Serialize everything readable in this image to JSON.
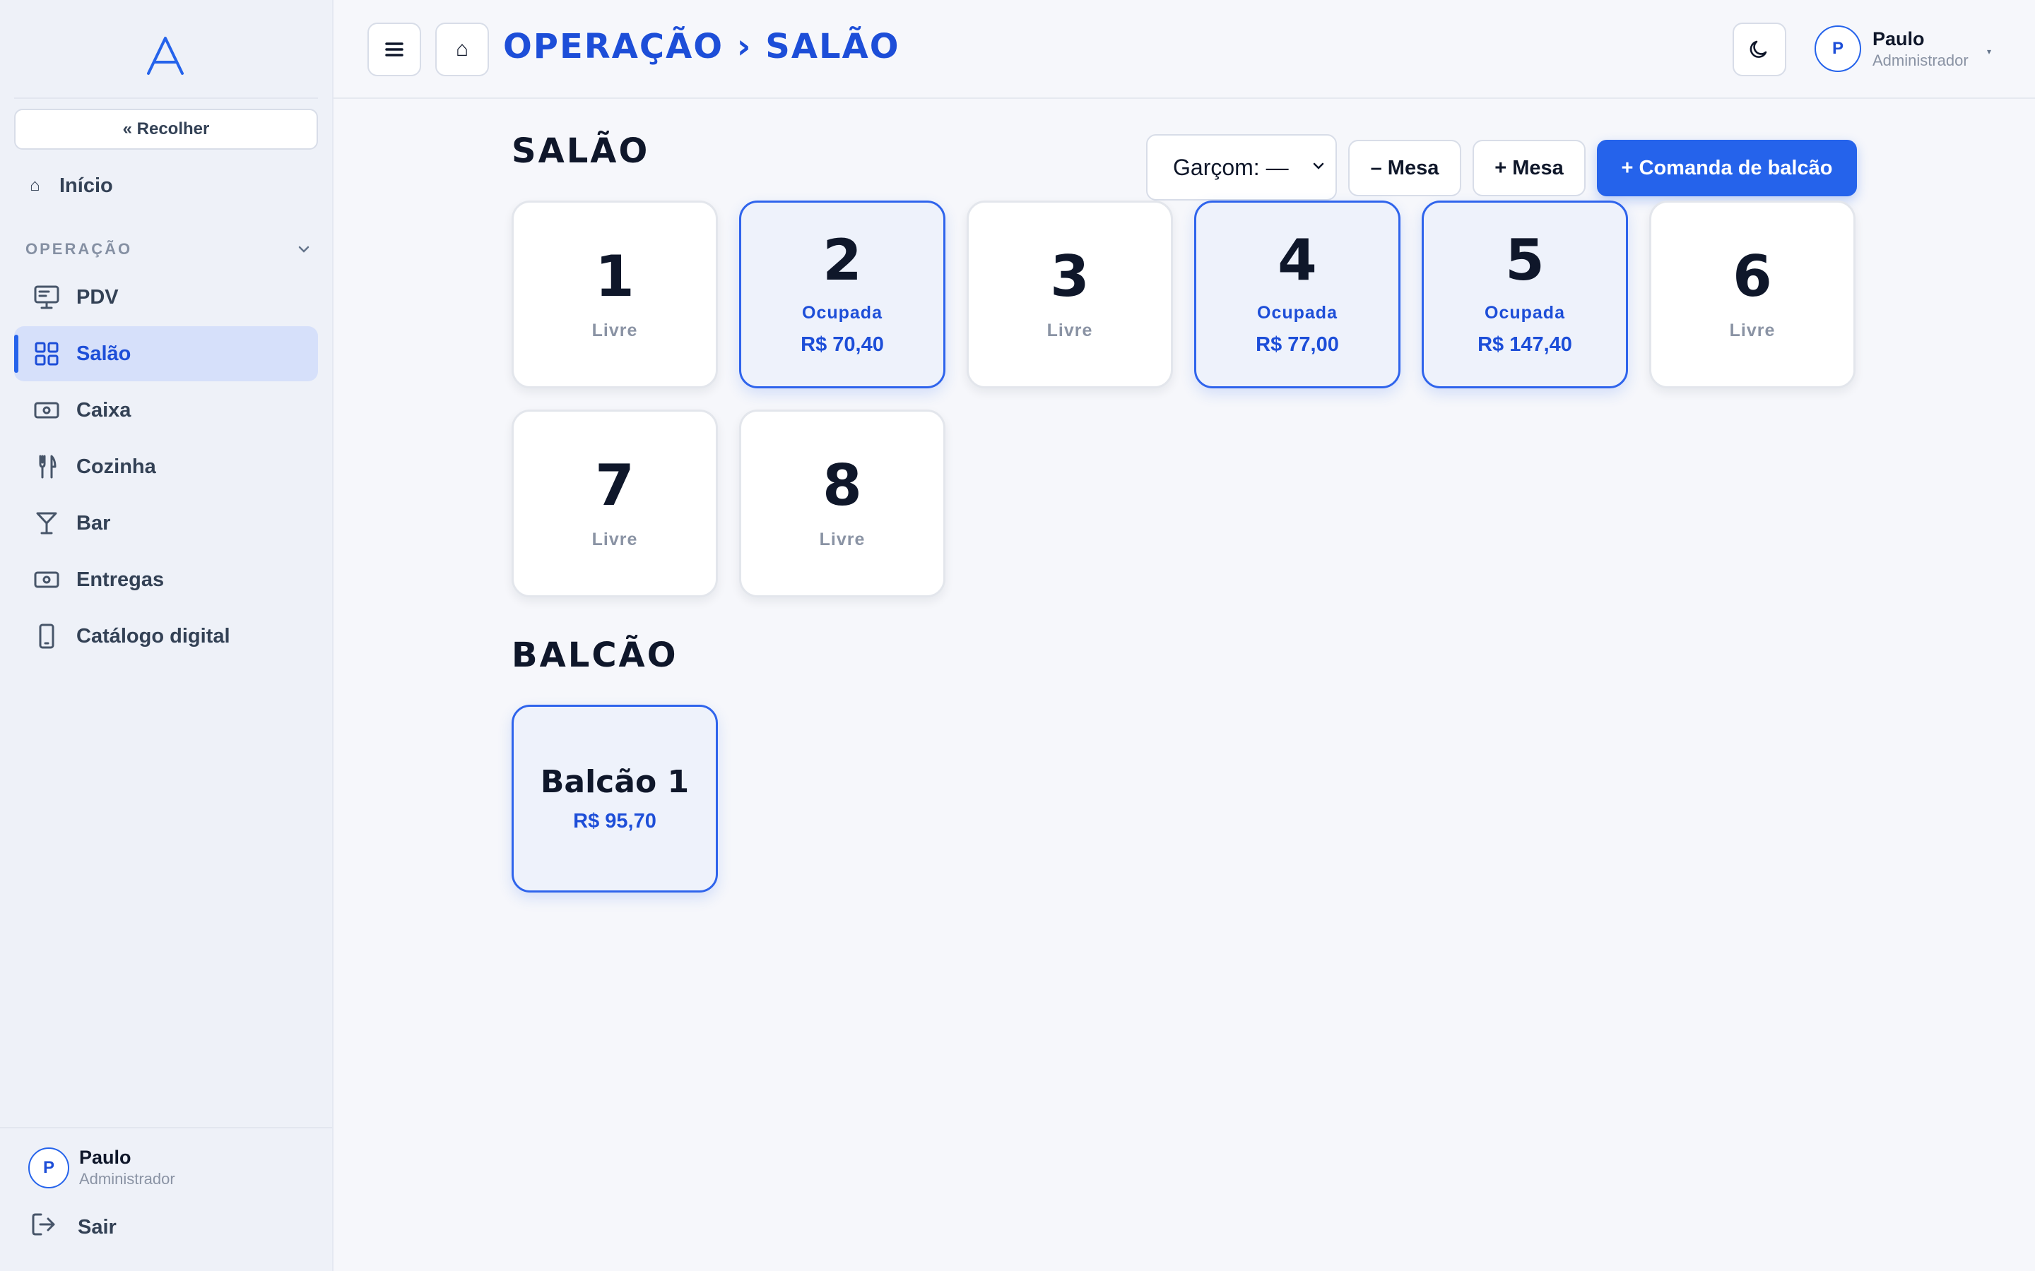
{
  "sidebar": {
    "logo_icon": "brand-a-logo",
    "collapse_label": "« Recolher",
    "home_label": "Início",
    "section_label": "OPERAÇÃO",
    "items": [
      {
        "label": "PDV",
        "icon": "monitor-icon"
      },
      {
        "label": "Salão",
        "icon": "grid-icon",
        "active": true
      },
      {
        "label": "Caixa",
        "icon": "cash-icon"
      },
      {
        "label": "Cozinha",
        "icon": "utensils-icon"
      },
      {
        "label": "Bar",
        "icon": "cocktail-icon"
      },
      {
        "label": "Entregas",
        "icon": "cash-icon"
      },
      {
        "label": "Catálogo digital",
        "icon": "smartphone-icon"
      }
    ],
    "user": {
      "initial": "P",
      "name": "Paulo",
      "role": "Administrador"
    },
    "logout_label": "Sair"
  },
  "topbar": {
    "breadcrumb": "OPERAÇÃO › SALÃO",
    "user": {
      "initial": "P",
      "name": "Paulo",
      "role": "Administrador"
    }
  },
  "salon": {
    "title": "SALÃO",
    "waiter_select": "Garçom: —",
    "remove_table_label": "– Mesa",
    "add_table_label": "+ Mesa",
    "new_counter_order_label": "+ Comanda de balcão",
    "tables": [
      {
        "number": "1",
        "status": "Livre",
        "amount": ""
      },
      {
        "number": "2",
        "status": "Ocupada",
        "amount": "R$ 70,40"
      },
      {
        "number": "3",
        "status": "Livre",
        "amount": ""
      },
      {
        "number": "4",
        "status": "Ocupada",
        "amount": "R$ 77,00"
      },
      {
        "number": "5",
        "status": "Ocupada",
        "amount": "R$ 147,40"
      },
      {
        "number": "6",
        "status": "Livre",
        "amount": ""
      },
      {
        "number": "7",
        "status": "Livre",
        "amount": ""
      },
      {
        "number": "8",
        "status": "Livre",
        "amount": ""
      }
    ]
  },
  "counter": {
    "title": "BALCÃO",
    "items": [
      {
        "name": "Balcão 1",
        "amount": "R$ 95,70"
      }
    ]
  },
  "colors": {
    "accent": "#2563eb",
    "accent_dark": "#1d4ed8",
    "active_bg": "#d6e0fa"
  }
}
